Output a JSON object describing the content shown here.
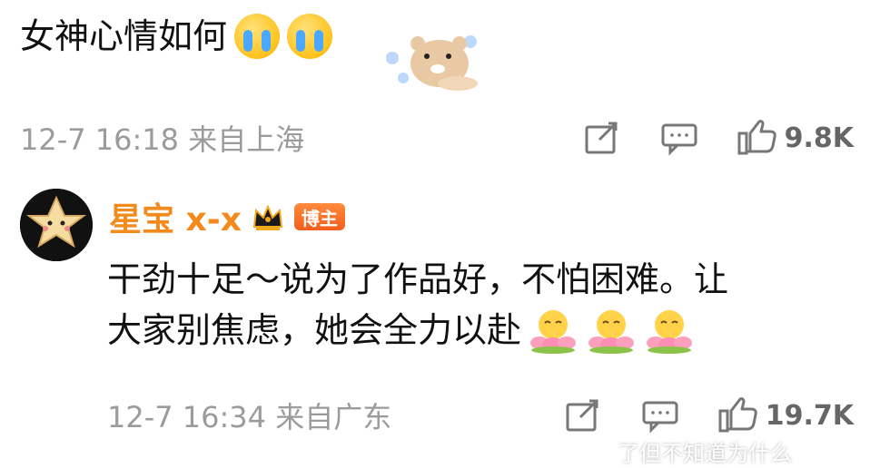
{
  "parent_comment": {
    "text": "女神心情如何",
    "emojis": [
      "crying-emoji",
      "crying-emoji"
    ],
    "sticker": "bear-sticker",
    "meta": "12-7 16:18 来自上海",
    "like_count": "9.8K",
    "icons": [
      "share-icon",
      "comment-icon",
      "like-icon"
    ]
  },
  "reply": {
    "avatar": "star-avatar",
    "username": "星宝 x-x",
    "badge": "博主",
    "crown_icon": "crown-icon",
    "text_line1": "干劲十足～说为了作品好，不怕困难。让",
    "text_line2": "大家别焦虑，她会全力以赴",
    "emojis": [
      "lotus-emoji",
      "lotus-emoji",
      "lotus-emoji"
    ],
    "meta": "12-7 16:34 来自广东",
    "like_count": "19.7K",
    "icons": [
      "share-icon",
      "comment-icon",
      "like-icon"
    ]
  },
  "watermark": "了但不知道为什么",
  "colors": {
    "username": "#f28a1c",
    "badge": "#f45f1b",
    "meta": "#9b9b9b"
  }
}
